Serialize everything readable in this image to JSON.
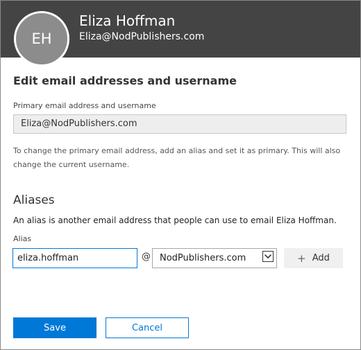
{
  "header": {
    "avatar_initials": "EH",
    "user_name": "Eliza Hoffman",
    "user_email": "Eliza@NodPublishers.com"
  },
  "edit_section": {
    "title": "Edit email addresses and username",
    "primary_label": "Primary email address and username",
    "primary_value": "Eliza@NodPublishers.com",
    "helper_text": "To change the primary email address, add an alias and set it as primary. This will also change the current username."
  },
  "aliases": {
    "title": "Aliases",
    "description": "An alias is another email address that people can use to email Eliza Hoffman.",
    "alias_label": "Alias",
    "alias_value": "eliza.hoffman",
    "at_sign": "@",
    "domain_selected": "NodPublishers.com",
    "add_label": "Add"
  },
  "footer": {
    "save_label": "Save",
    "cancel_label": "Cancel"
  },
  "colors": {
    "header_bg": "#444444",
    "avatar_bg": "#8c8c8c",
    "accent": "#0078d7"
  }
}
